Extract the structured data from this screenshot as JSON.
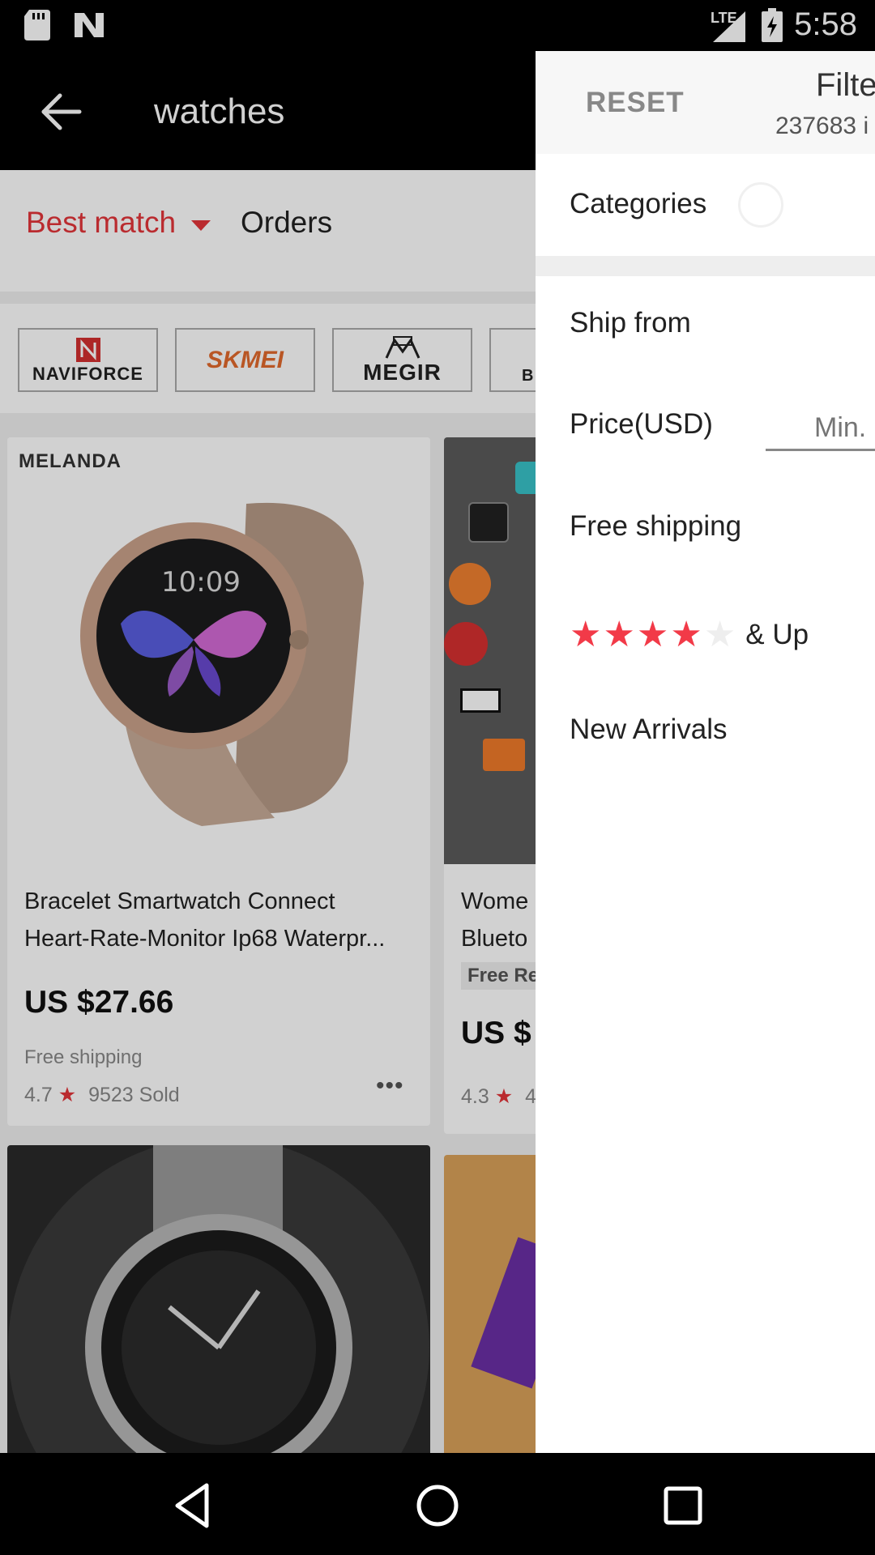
{
  "status_bar": {
    "time": "5:58",
    "network_label": "LTE",
    "icons": [
      "sd-card-icon",
      "n-notification-icon",
      "signal-icon",
      "battery-charging-icon"
    ]
  },
  "app_bar": {
    "search_query": "watches",
    "back_icon": "arrow-left-icon"
  },
  "sort_bar": {
    "best_match": "Best match",
    "orders": "Orders",
    "accent_color": "#e3353a"
  },
  "brands": [
    "NAVIFORCE",
    "SKMEI",
    "MEGIR",
    "B"
  ],
  "products": [
    {
      "brand_label": "MELANDA",
      "title_line1": "Bracelet Smartwatch Connect",
      "title_line2": "Heart-Rate-Monitor Ip68 Waterpr...",
      "price": "US $27.66",
      "shipping": "Free shipping",
      "rating": "4.7",
      "sold": "9523 Sold"
    },
    {
      "title_line1": "Wome",
      "title_line2": "Blueto",
      "badge": "Free Re",
      "price": "US $",
      "rating": "4.3",
      "sold": "4"
    }
  ],
  "filter_drawer": {
    "reset": "RESET",
    "title": "Filte",
    "result_count": "237683 i",
    "categories": "Categories",
    "ship_from": "Ship from",
    "price_label": "Price(USD)",
    "price_min_placeholder": "Min.",
    "free_shipping": "Free shipping",
    "rating_filled_stars": 4,
    "rating_total_stars": 5,
    "rating_suffix": "& Up",
    "new_arrivals": "New Arrivals"
  },
  "nav_bar": {
    "icons": [
      "back-triangle-icon",
      "home-circle-icon",
      "recents-square-icon"
    ]
  }
}
